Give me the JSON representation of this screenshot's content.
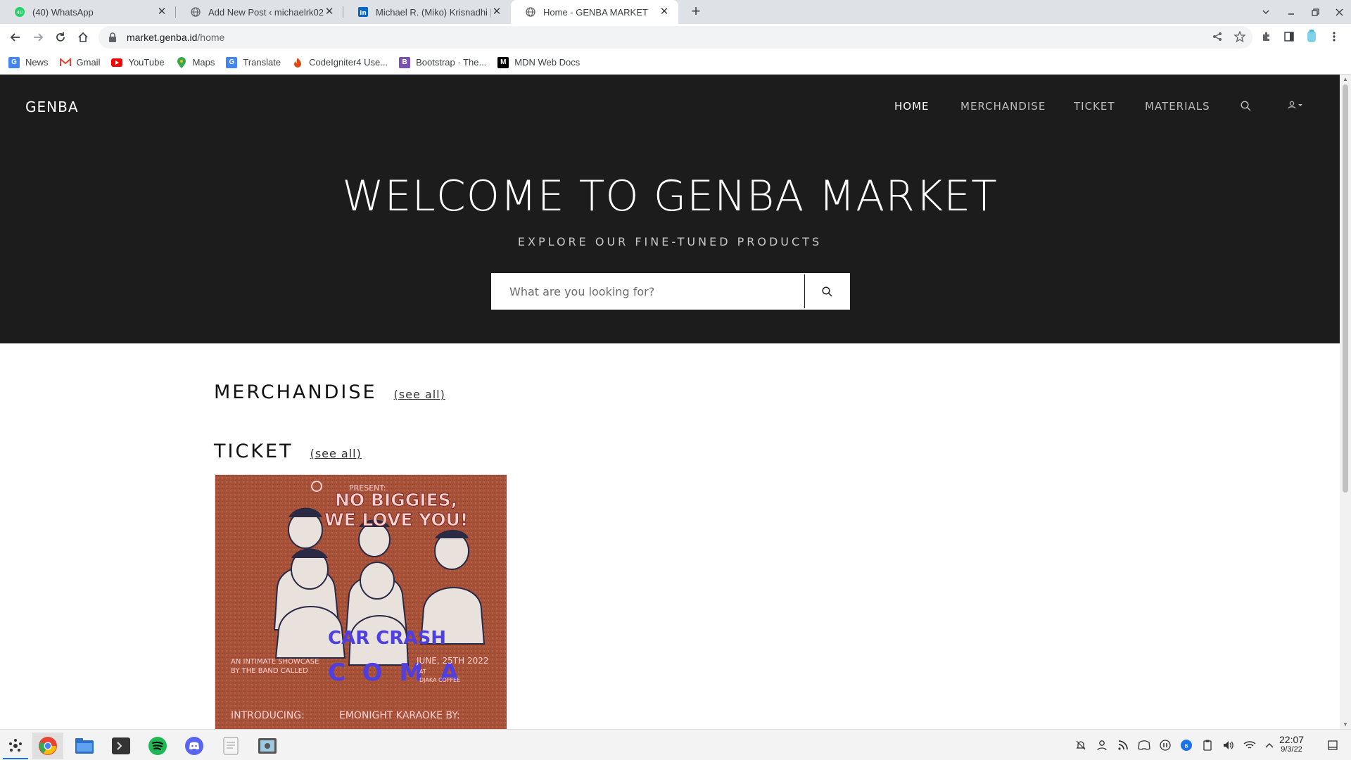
{
  "browser": {
    "tabs": [
      {
        "title": "(40) WhatsApp",
        "icon": "whatsapp-icon"
      },
      {
        "title": "Add New Post ‹ michaelrk02 —",
        "icon": "globe-icon"
      },
      {
        "title": "Michael R. (Miko) Krisnadhi | L",
        "icon": "linkedin-icon"
      },
      {
        "title": "Home - GENBA MARKET",
        "icon": "globe-icon",
        "active": true
      }
    ],
    "address": {
      "host": "market.genba.id",
      "path": "/home"
    },
    "bookmarks": [
      {
        "label": "News",
        "icon": "google-news-icon"
      },
      {
        "label": "Gmail",
        "icon": "gmail-icon"
      },
      {
        "label": "YouTube",
        "icon": "youtube-icon"
      },
      {
        "label": "Maps",
        "icon": "maps-icon"
      },
      {
        "label": "Translate",
        "icon": "translate-icon"
      },
      {
        "label": "CodeIgniter4 Use...",
        "icon": "codeigniter-icon"
      },
      {
        "label": "Bootstrap · The...",
        "icon": "bootstrap-icon"
      },
      {
        "label": "MDN Web Docs",
        "icon": "mdn-icon"
      }
    ]
  },
  "site": {
    "brand": "GENBA",
    "nav": [
      {
        "label": "HOME",
        "active": true
      },
      {
        "label": "MERCHANDISE"
      },
      {
        "label": "TICKET"
      },
      {
        "label": "MATERIALS"
      }
    ],
    "hero": {
      "title": "WELCOME TO GENBA MARKET",
      "subtitle": "EXPLORE OUR FINE-TUNED PRODUCTS",
      "search_placeholder": "What are you looking for?"
    },
    "sections": [
      {
        "title": "MERCHANDISE",
        "link": "(see all)"
      },
      {
        "title": "TICKET",
        "link": "(see all)"
      }
    ],
    "ticket_poster": {
      "lines": [
        "PRESENT:",
        "NO BIGGIES,",
        "WE LOVE YOU!",
        "CAR CRASH",
        "C O M A",
        "AN INTIMATE SHOWCASE",
        "BY THE BAND CALLED",
        "JUNE, 25TH 2022",
        "AT",
        "DJAKA COFFEE",
        "INTRODUCING:",
        "EMONIGHT KARAOKE BY:"
      ]
    }
  },
  "taskbar": {
    "apps": [
      "launcher-icon",
      "chrome-icon",
      "files-icon",
      "terminal-icon",
      "spotify-icon",
      "discord-icon",
      "text-editor-icon",
      "screenshot-icon"
    ],
    "time": "22:07",
    "date": "9/3/22"
  },
  "colors": {
    "hero_bg": "#1c1c1c",
    "poster_bg": "#a9523a",
    "poster_text": "#ffd1cf",
    "poster_accent": "#4f3fe0"
  }
}
